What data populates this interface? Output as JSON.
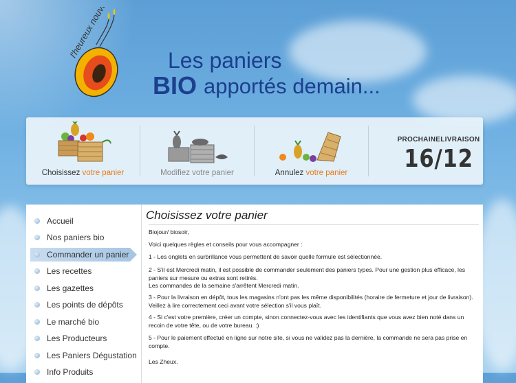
{
  "brand": {
    "logo_text": "l'heureux nouveau"
  },
  "headline": {
    "line1": "Les paniers",
    "line2_bold": "BIO",
    "line2_rest": "apportés demain..."
  },
  "steps": [
    {
      "label_plain": "Choisissez",
      "label_accent": "votre panier"
    },
    {
      "label_plain": "Modifiez votre panier",
      "label_accent": ""
    },
    {
      "label_plain": "Annulez",
      "label_accent": "votre panier"
    }
  ],
  "delivery": {
    "title": "PROCHAINELIVRAISON",
    "date": "16/12"
  },
  "nav": [
    {
      "label": "Accueil"
    },
    {
      "label": "Nos paniers bio"
    },
    {
      "label": "Commander un panier"
    },
    {
      "label": "Les recettes"
    },
    {
      "label": "Les gazettes"
    },
    {
      "label": "Les points de dépôts"
    },
    {
      "label": "Le marché bio"
    },
    {
      "label": "Les Producteurs"
    },
    {
      "label": "Les Paniers Dégustation"
    },
    {
      "label": "Info Produits"
    }
  ],
  "content": {
    "title": "Choisissez votre panier",
    "greeting": "Biojour/ biosoir,",
    "intro": "Voici quelques règles et conseils pour vous accompagner :",
    "rule1": "1 - Les onglets en surbrillance vous permettent de savoir quelle formule est sélectionnée.",
    "rule2": "2 - S'il est Mercredi matin, il est possible de commander seulement des paniers types. Pour une gestion plus efficace, les paniers sur mesure ou extras sont retirés.",
    "rule2_bold": "Les commandes de la semaine s'arrêtent Mercredi matin.",
    "rule3": "3 - Pour la livraison en dépôt, tous les magasins n'ont pas les même disponibilités (horaire de fermeture et jour de livraison). Veillez à lire correctement ceci avant votre sélection s'il vous plaît.",
    "rule4": "4 - Si c'est votre première, créer un compte, sinon connectez-vous avec les identifiants que vous avez bien noté dans un recoin de votre tête, ou de votre bureau. :)",
    "rule5": "5 - Pour le paiement effectué en ligne sur notre site, si vous ne validez pas la dernière, la commande ne sera pas prise en compte.",
    "signature": "Les Zheux."
  },
  "colors": {
    "title_blue": "#1c3f8e",
    "accent_orange": "#e87c1e",
    "sky": "#6fb0e2"
  }
}
